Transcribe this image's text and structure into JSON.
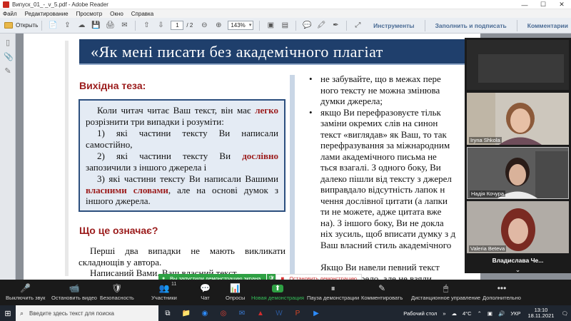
{
  "window": {
    "title": "Випуск_01_-_v_5.pdf - Adobe Reader",
    "controls": [
      "—",
      "☐",
      "✕"
    ]
  },
  "menu": [
    "Файл",
    "Редактирование",
    "Просмотр",
    "Окно",
    "Справка"
  ],
  "toolbar": {
    "open_label": "Открыть",
    "page_current": "1",
    "page_count": "/ 2",
    "zoom": "143%",
    "tools_label": "Инструменты",
    "fill_sign_label": "Заполнить и подписать",
    "comments_label": "Комментарии"
  },
  "document": {
    "banner_title": "«Як мені писати без академічного плагіат",
    "section1_heading": "Вихідна теза:",
    "quote": {
      "p1_a": "Коли читач читає Ваш текст, він має ",
      "p1_hl": "легко",
      "p1_b": " розрізнити три випадки і розуміти:",
      "p2": "1) які частини тексту Ви написали самостійно,",
      "p3_a": "2) які частини тексту Ви ",
      "p3_hl": "дослівно",
      "p3_b": " запозичили з іншого джерела і",
      "p4_a": "3) які частини тексту Ви написали Вашими ",
      "p4_hl": "власними словами",
      "p4_b": ", але на основі думок з іншого джерела."
    },
    "section2_heading": "Що це означає?",
    "body_p1": "Перші два випадки не мають викликати складнощів у автора.",
    "body_p2": "Написаний Вами. Ваш власний текст",
    "right_bullet1_lines": [
      "не забувайте, що в межах пере",
      "ного тексту не можна змінюва",
      "думки джерела;"
    ],
    "right_bullet2_lines": [
      "якщо Ви перефразовуєте тільк",
      "заміни окремих слів на синон",
      "текст «виглядав» як Ваш, то так",
      "перефразування за міжнародним",
      "лами академічного письма не",
      "ться взагалі. З одного боку, Ви",
      "далеко пішли від тексту з джерел",
      "виправдало відсутність лапок н",
      "чення дослівної цитати (а лапки",
      "ти не можете, адже цитата вже",
      "на). З іншого боку, Ви не докла",
      "ніх зусиль, щоб вписати думку з д",
      "Ваш власний стиль академічного"
    ],
    "right_para_lines": [
      "Якщо Ви навели певний текст",
      "вання на джерело, але не взяли"
    ]
  },
  "video": {
    "participants": [
      {
        "name": "Iryna Shkola"
      },
      {
        "name": "Надія Кочура"
      },
      {
        "name": "Valeria Beteva"
      }
    ],
    "active_speaker": "Владислава  Че...",
    "chevron": "⌄"
  },
  "share_banner": {
    "status": "Вы запустили демонстрацию экрана",
    "stop": "Остановить демонстрацию"
  },
  "zoom_controls": [
    {
      "label": "Выключить звук",
      "icon": "🎤"
    },
    {
      "label": "Остановить видео",
      "icon": "📹"
    },
    {
      "label": "Безопасность",
      "icon": "🛡"
    },
    {
      "label": "Участники",
      "icon": "👥",
      "count": "11"
    },
    {
      "label": "Чат",
      "icon": "💬"
    },
    {
      "label": "Опросы",
      "icon": "📊"
    },
    {
      "label": "Новая демонстрация",
      "icon": "⬆"
    },
    {
      "label": "Пауза демонстрации",
      "icon": "⏸"
    },
    {
      "label": "Комментировать",
      "icon": "✎"
    },
    {
      "label": "Дистанционное управление",
      "icon": "🖱"
    },
    {
      "label": "Дополнительно",
      "icon": "•••"
    }
  ],
  "taskbar": {
    "search_placeholder": "Введите здесь текст для поиска",
    "desktop_label": "Рабочий стол",
    "weather": "4°C",
    "lang": "УКР",
    "time": "13:10",
    "date": "18.11.2021"
  },
  "colors": {
    "banner": "#1f3f6c",
    "heading_red": "#9b1b1b",
    "share_green": "#2ea043"
  }
}
